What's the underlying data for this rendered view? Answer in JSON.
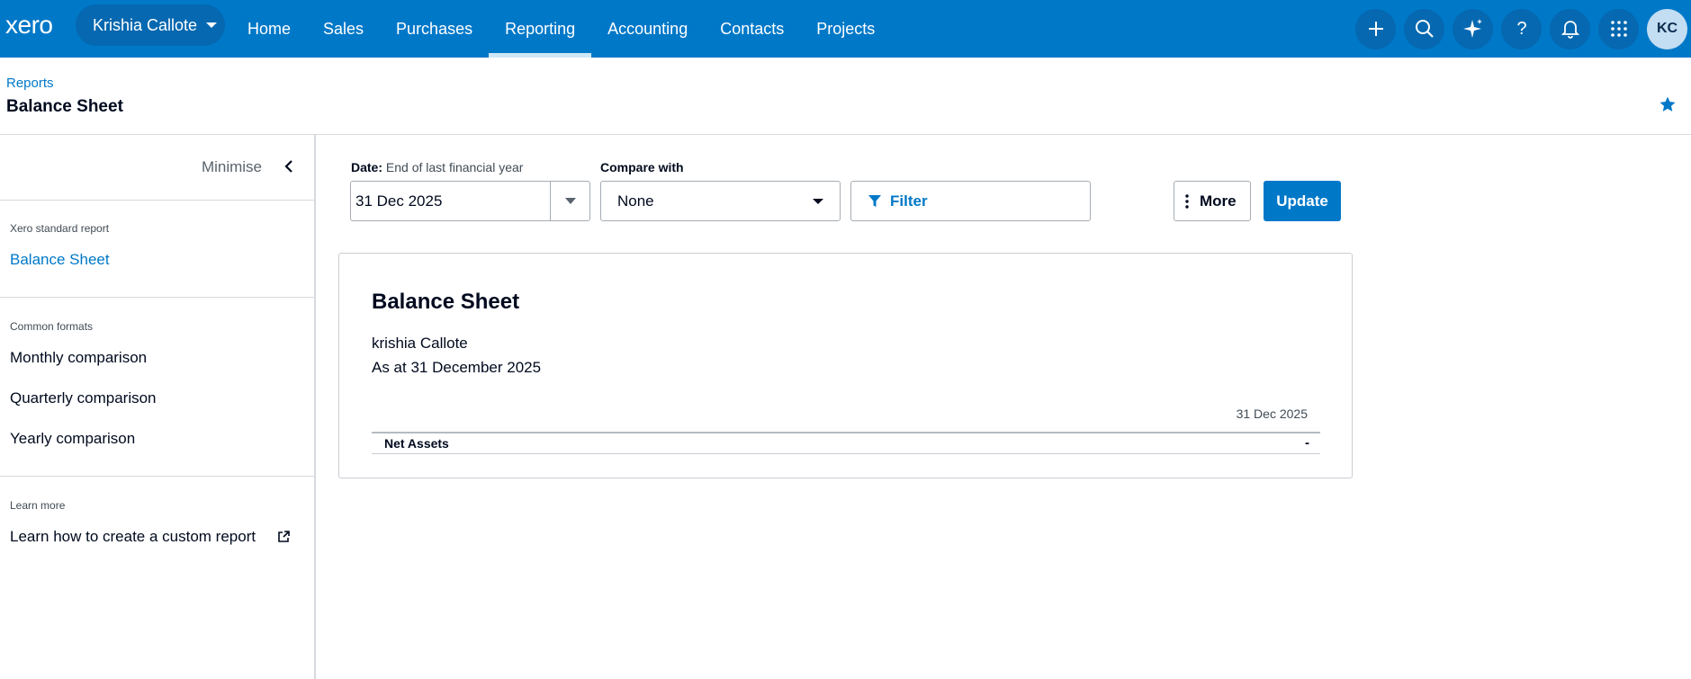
{
  "topnav": {
    "logo": "xero",
    "org_name": "Krishia Callote",
    "links": [
      "Home",
      "Sales",
      "Purchases",
      "Reporting",
      "Accounting",
      "Contacts",
      "Projects"
    ],
    "active_link": "Reporting",
    "avatar_initials": "KC",
    "icons": [
      "plus-icon",
      "search-icon",
      "ai-sparkle-icon",
      "help-icon",
      "bell-icon",
      "apps-grid-icon"
    ]
  },
  "header": {
    "breadcrumb": "Reports",
    "title": "Balance Sheet"
  },
  "sidebar": {
    "minimise_label": "Minimise",
    "sections": [
      {
        "heading": "Xero standard report",
        "items": [
          "Balance Sheet"
        ]
      },
      {
        "heading": "Common formats",
        "items": [
          "Monthly comparison",
          "Quarterly comparison",
          "Yearly comparison"
        ]
      },
      {
        "heading": "Learn more",
        "items": [
          "Learn how to create a custom report"
        ]
      }
    ]
  },
  "controls": {
    "date_label": "Date:",
    "date_label_value": "End of last financial year",
    "date_value": "31 Dec 2025",
    "compare_label": "Compare with",
    "compare_value": "None",
    "filter_label": "Filter",
    "more_label": "More",
    "update_label": "Update"
  },
  "report": {
    "title": "Balance Sheet",
    "org": "krishia Callote",
    "as_at": "As at 31 December 2025",
    "column_header": "31 Dec 2025",
    "rows": [
      {
        "label": "Net Assets",
        "value": "-"
      }
    ]
  },
  "colors": {
    "brand": "#0078c8",
    "nav_button": "#0568b0",
    "text": "#000a1e",
    "border": "#a6acb3"
  }
}
